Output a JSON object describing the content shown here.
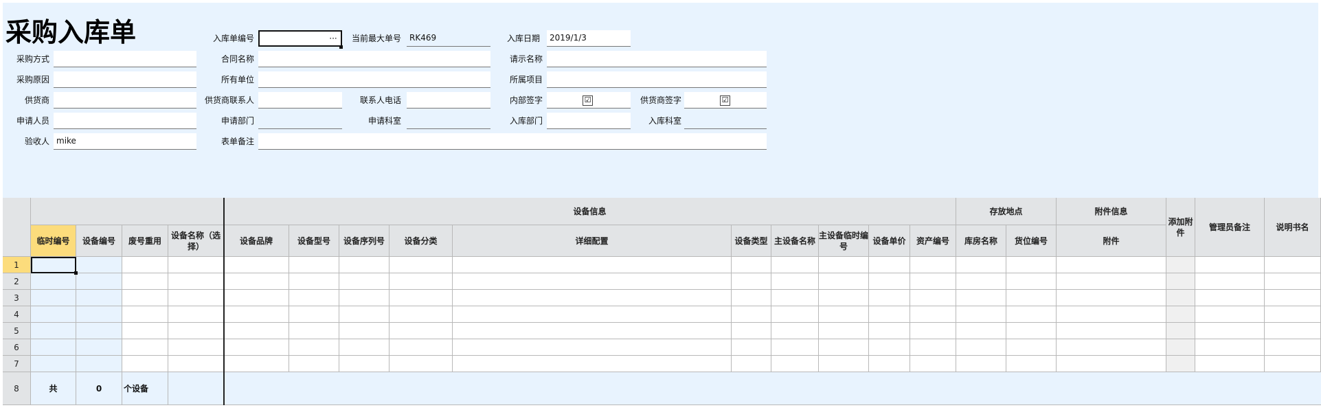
{
  "form": {
    "title": "采购入库单",
    "labels": {
      "entry_no": "入库单编号",
      "max_no": "当前最大单号",
      "entry_date": "入库日期",
      "purchase_method": "采购方式",
      "contract_name": "合同名称",
      "request_name": "请示名称",
      "purchase_reason": "采购原因",
      "owner_unit": "所有单位",
      "project": "所属项目",
      "supplier": "供货商",
      "supplier_contact": "供货商联系人",
      "contact_phone": "联系人电话",
      "internal_sign": "内部签字",
      "supplier_sign": "供货商签字",
      "applicant": "申请人员",
      "apply_dept": "申请部门",
      "apply_section": "申请科室",
      "entry_dept": "入库部门",
      "entry_section": "入库科室",
      "receiver": "验收人",
      "remark": "表单备注"
    },
    "values": {
      "entry_no": "",
      "max_no": "RK469",
      "entry_date": "2019/1/3",
      "purchase_method": "",
      "contract_name": "",
      "request_name": "",
      "purchase_reason": "",
      "owner_unit": "",
      "project": "",
      "supplier": "",
      "supplier_contact": "",
      "contact_phone": "",
      "internal_sign_checked": true,
      "supplier_sign_checked": true,
      "internal_sign_mark": "☑",
      "supplier_sign_mark": "☑",
      "applicant": "",
      "apply_dept": "",
      "apply_section": "",
      "entry_dept": "",
      "entry_section": "",
      "receiver": "mike",
      "remark": ""
    },
    "ellipsis": "···"
  },
  "grid": {
    "groups": {
      "device_info": "设备信息",
      "storage": "存放地点",
      "attachment_info": "附件信息"
    },
    "columns": {
      "temp_no": "临时编号",
      "device_no": "设备编号",
      "reuse": "废号重用",
      "device_name": "设备名称（选择）",
      "brand": "设备品牌",
      "model": "设备型号",
      "serial": "设备序列号",
      "category": "设备分类",
      "detail": "详细配置",
      "type": "设备类型",
      "main_name": "主设备名称",
      "main_temp_no": "主设备临时编号",
      "unit_price": "设备单价",
      "asset_no": "资产编号",
      "warehouse": "库房名称",
      "location": "货位编号",
      "attachment": "附件",
      "add_attachment": "添加附件",
      "admin_remark": "管理员备注",
      "manual": "说明书名"
    },
    "row_numbers": [
      "1",
      "2",
      "3",
      "4",
      "5",
      "6",
      "7",
      "8"
    ],
    "total": {
      "label": "共",
      "count": "0",
      "unit": "个设备"
    }
  }
}
